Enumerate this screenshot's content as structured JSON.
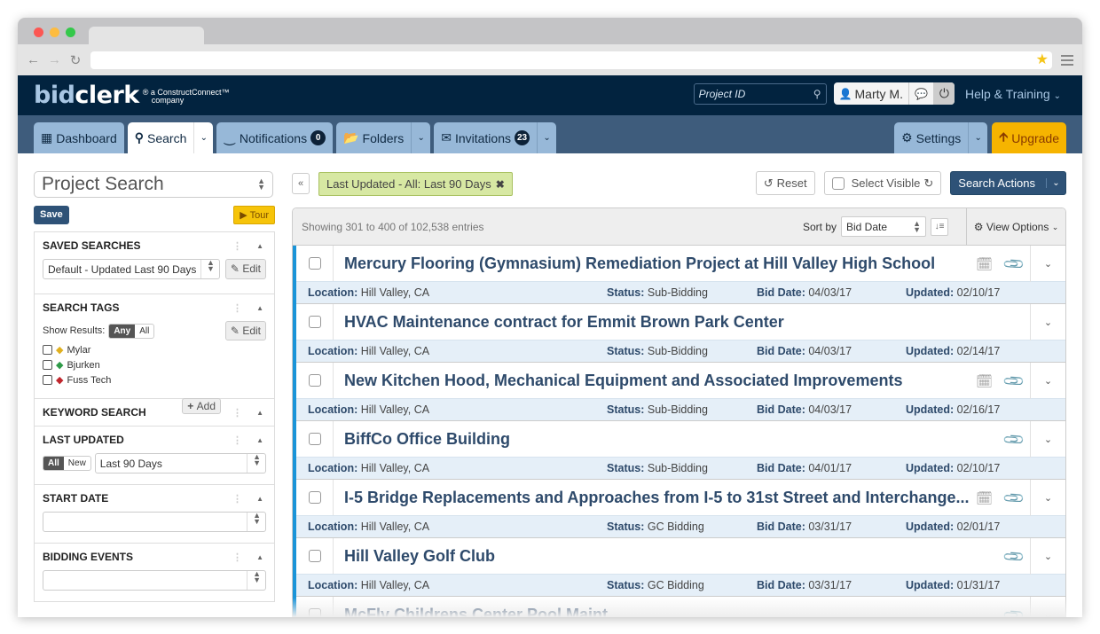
{
  "browser": {
    "traffic_colors": [
      "#fc5753",
      "#fdbc40",
      "#34c84a"
    ],
    "back_icon": "←",
    "forward_icon": "→",
    "reload_icon": "↻",
    "bookmark_icon": "★"
  },
  "header": {
    "logo_bid": "bid",
    "logo_clerk": "clerk",
    "logo_reg": "®",
    "logo_sub_line1": "a ConstructConnect™",
    "logo_sub_line2": "company",
    "project_id_placeholder": "Project ID",
    "user_name": "Marty M.",
    "help_label": "Help & Training"
  },
  "tabs": [
    {
      "label": "Dashboard",
      "icon": "dashboard-icon"
    },
    {
      "label": "Search",
      "icon": "search-icon",
      "active": true
    },
    {
      "label": "Notifications",
      "badge": "0"
    },
    {
      "label": "Folders"
    },
    {
      "label": "Invitations",
      "badge": "23"
    }
  ],
  "tabs_right": {
    "settings_label": "Settings",
    "upgrade_label": "Upgrade"
  },
  "sidebar": {
    "search_type": "Project Search",
    "save_label": "Save",
    "tour_label": "Tour",
    "saved_searches": {
      "title": "SAVED SEARCHES",
      "selected": "Default - Updated Last 90 Days",
      "edit_label": "Edit"
    },
    "search_tags": {
      "title": "SEARCH TAGS",
      "show_results_label": "Show Results:",
      "any_label": "Any",
      "all_label": "All",
      "edit_label": "Edit",
      "tags": [
        {
          "name": "Mylar",
          "color": "#e0b020"
        },
        {
          "name": "Bjurken",
          "color": "#2e9a48"
        },
        {
          "name": "Fuss Tech",
          "color": "#c0262d"
        }
      ]
    },
    "keyword_search": {
      "title": "KEYWORD SEARCH",
      "add_label": "Add"
    },
    "last_updated": {
      "title": "LAST UPDATED",
      "all_label": "All",
      "new_label": "New",
      "selected": "Last 90 Days"
    },
    "start_date": {
      "title": "START DATE",
      "selected": ""
    },
    "bidding_events": {
      "title": "BIDDING EVENTS",
      "selected": ""
    }
  },
  "main": {
    "collapse_label": "«",
    "filter_chip": "Last Updated - All: Last 90 Days",
    "reset_label": "Reset",
    "select_visible_label": "Select Visible",
    "search_actions_label": "Search Actions",
    "showing_text": "Showing 301 to 400 of 102,538 entries",
    "sort_by_label": "Sort by",
    "sort_value": "Bid Date",
    "view_options_label": "View Options",
    "labels": {
      "location": "Location:",
      "status": "Status:",
      "bid_date": "Bid Date:",
      "updated": "Updated:"
    },
    "projects": [
      {
        "title": "Mercury Flooring (Gymnasium) Remediation Project at Hill Valley High School",
        "location": "Hill Valley, CA",
        "status": "Sub-Bidding",
        "bid_date": "04/03/17",
        "updated": "02/10/17",
        "calendar": true,
        "attachment": true
      },
      {
        "title": "HVAC Maintenance contract for Emmit Brown Park Center",
        "location": "Hill Valley, CA",
        "status": "Sub-Bidding",
        "bid_date": "04/03/17",
        "updated": "02/14/17",
        "calendar": false,
        "attachment": false
      },
      {
        "title": "New Kitchen Hood, Mechanical Equipment and Associated Improvements",
        "location": "Hill Valley, CA",
        "status": "Sub-Bidding",
        "bid_date": "04/03/17",
        "updated": "02/16/17",
        "calendar": true,
        "attachment": true
      },
      {
        "title": "BiffCo Office Building",
        "location": "Hill Valley, CA",
        "status": "Sub-Bidding",
        "bid_date": "04/01/17",
        "updated": "02/10/17",
        "calendar": false,
        "attachment": true
      },
      {
        "title": "I-5 Bridge Replacements and Approaches from I-5 to 31st Street and Interchange...",
        "location": "Hill Valley, CA",
        "status": "GC Bidding",
        "bid_date": "03/31/17",
        "updated": "02/01/17",
        "calendar": true,
        "attachment": true
      },
      {
        "title": "Hill Valley Golf Club",
        "location": "Hill Valley, CA",
        "status": "GC Bidding",
        "bid_date": "03/31/17",
        "updated": "01/31/17",
        "calendar": false,
        "attachment": true
      },
      {
        "title": "McFly Childrens Center Pool Maint...",
        "location": "",
        "status": "",
        "bid_date": "",
        "updated": "",
        "calendar": false,
        "attachment": true
      }
    ]
  }
}
